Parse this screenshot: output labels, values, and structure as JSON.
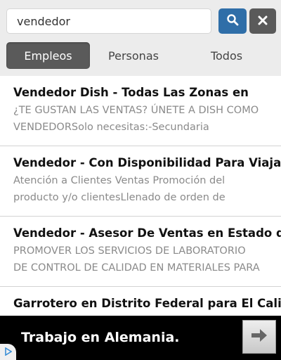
{
  "search": {
    "value": "vendedor",
    "placeholder": ""
  },
  "icons": {
    "search": "search-icon",
    "clear": "close-icon",
    "ad_next": "arrow-right-icon",
    "ad_choices": "ad-choices-icon"
  },
  "colors": {
    "search_button": "#2f6ea8",
    "clear_button": "#5a5a5a",
    "active_tab": "#5a5a5a",
    "title_text": "#111111",
    "desc_text": "#8a8a8a"
  },
  "tabs": [
    {
      "label": "Empleos",
      "active": true
    },
    {
      "label": "Personas",
      "active": false
    },
    {
      "label": "Todos",
      "active": false
    }
  ],
  "results": [
    {
      "title": "Vendedor Dish - Todas Las Zonas en",
      "line1": "¿TE GUSTAN LAS VENTAS? ÚNETE A DISH COMO",
      "line2": "VENDEDORSolo necesitas:-Secundaria"
    },
    {
      "title": "Vendedor - Con Disponibilidad Para Viajar",
      "line1": "Atención a Clientes Ventas Promoción del",
      "line2": "producto y/o clientesLlenado de orden de"
    },
    {
      "title": "Vendedor - Asesor De Ventas en Estado de",
      "line1": "PROMOVER LOS SERVICIOS DE LABORATORIO",
      "line2": "DE CONTROL DE CALIDAD EN MATERIALES PARA"
    },
    {
      "title": "Garrotero en Distrito Federal para El Califa",
      "line1": "",
      "line2": ""
    }
  ],
  "ad": {
    "text": "Trabajo en Alemania."
  }
}
